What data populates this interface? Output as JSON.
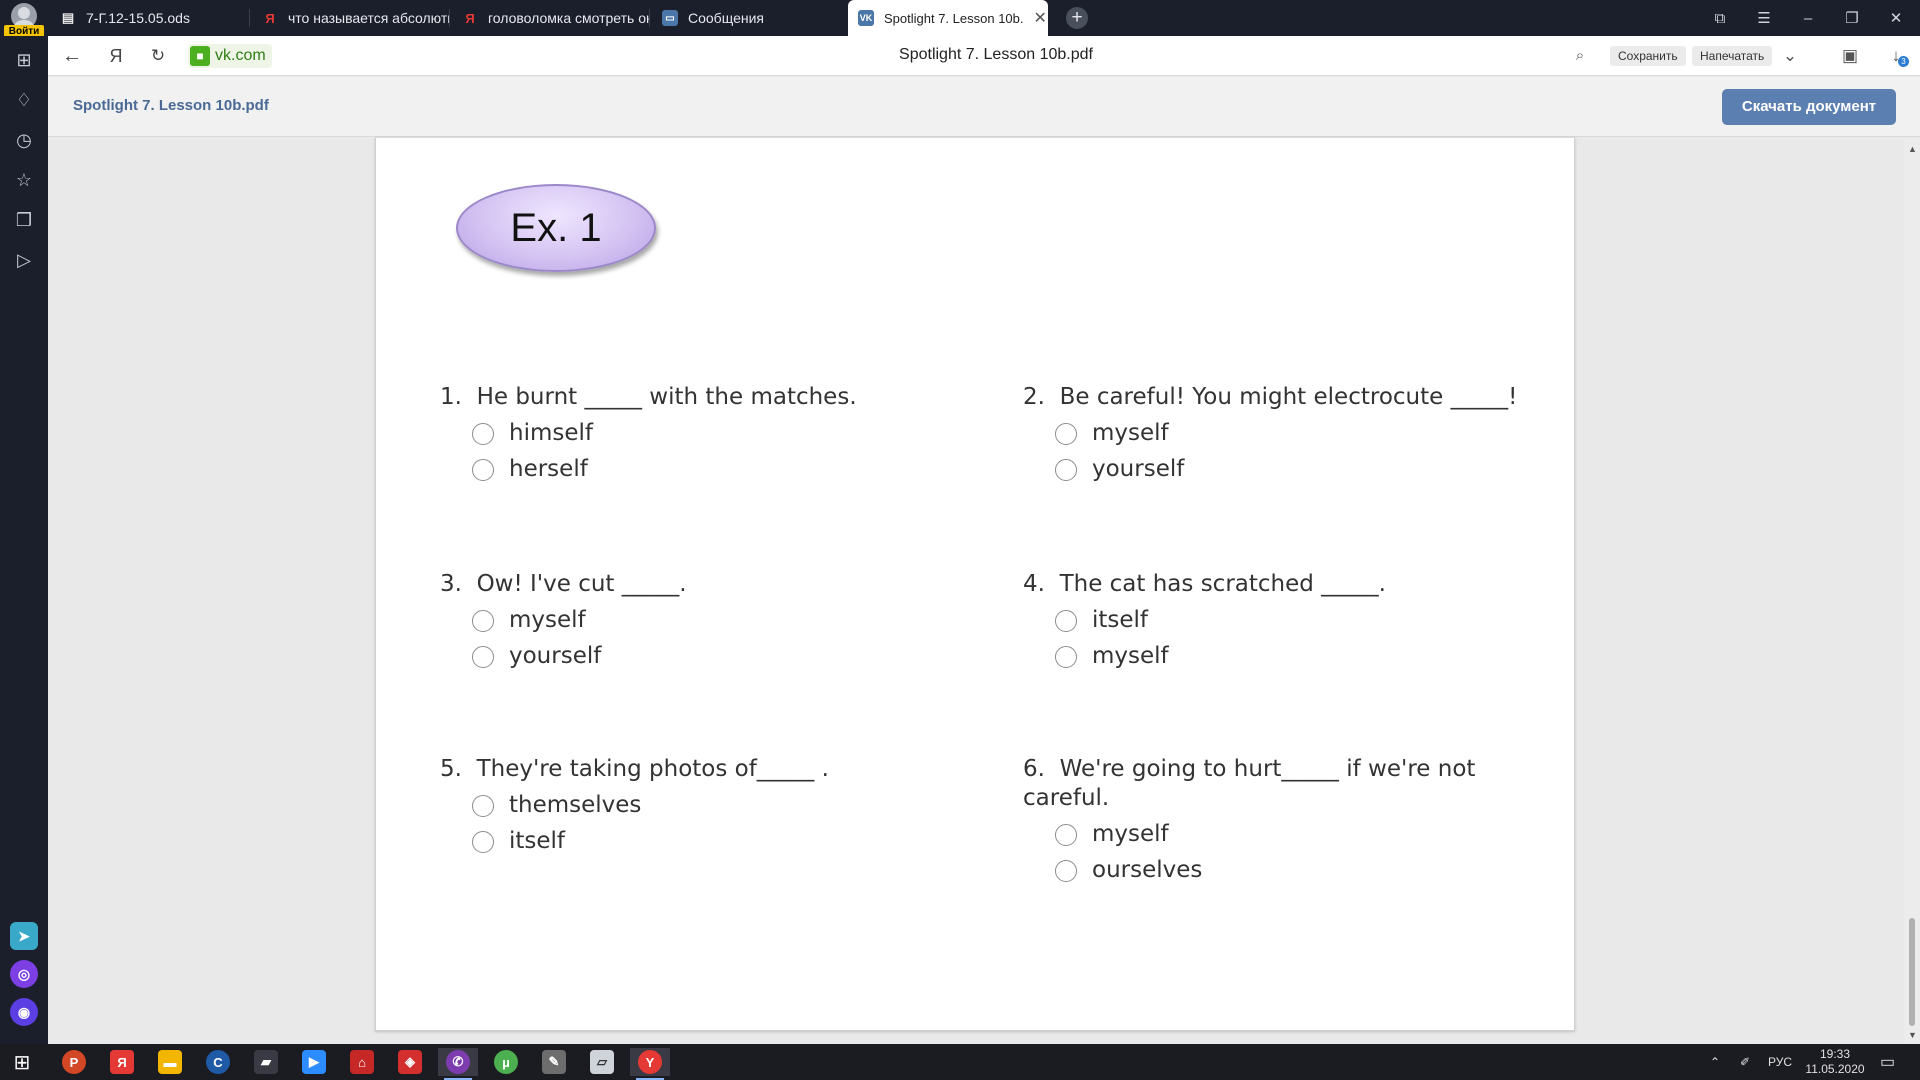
{
  "browser": {
    "login_label": "Войти",
    "tabs": [
      {
        "title": "7-Г.12-15.05.ods",
        "icon": "spreadsheet-icon",
        "active": false
      },
      {
        "title": "что называется абсолютн",
        "icon": "yandex-icon",
        "active": false
      },
      {
        "title": "головоломка смотреть он",
        "icon": "yandex-icon",
        "active": false
      },
      {
        "title": "Сообщения",
        "icon": "messages-icon",
        "active": false
      },
      {
        "title": "Spotlight 7. Lesson 10b.",
        "icon": "vk-icon",
        "active": true
      }
    ],
    "address": {
      "domain": "vk.com",
      "page_title": "Spotlight 7. Lesson 10b.pdf",
      "save_label": "Сохранить",
      "print_label": "Напечатать",
      "downloads_count": "3"
    }
  },
  "viewer": {
    "doc_name": "Spotlight 7. Lesson 10b.pdf",
    "download_label": "Скачать документ"
  },
  "document": {
    "exercise_label": "Ex. 1",
    "questions": [
      {
        "number": "1.",
        "text": "He burnt _____ with the matches.",
        "options": [
          "himself",
          "herself"
        ]
      },
      {
        "number": "2.",
        "text": "Be careful! You might electrocute _____!",
        "options": [
          "myself",
          "yourself"
        ]
      },
      {
        "number": "3.",
        "text": "Ow! I've cut _____.",
        "options": [
          "myself",
          "yourself"
        ]
      },
      {
        "number": "4.",
        "text": "The cat has scratched _____.",
        "options": [
          "itself",
          "myself"
        ]
      },
      {
        "number": "5.",
        "text": "They're taking photos of_____ .",
        "options": [
          "themselves",
          "itself"
        ]
      },
      {
        "number": "6.",
        "text": "We're going to hurt_____ if we're not careful.",
        "options": [
          "myself",
          "ourselves"
        ]
      }
    ]
  },
  "taskbar": {
    "language": "РУС",
    "time": "19:33",
    "date": "11.05.2020"
  },
  "colors": {
    "browser_chrome": "#1b1f2b",
    "accent_button": "#5b7fb0",
    "doc_name": "#4a6a95",
    "badge_fill": "#d4c3f2"
  }
}
